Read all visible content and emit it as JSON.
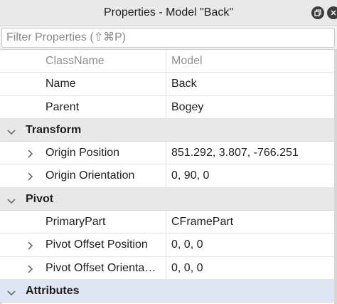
{
  "window": {
    "title": "Properties - Model \"Back\""
  },
  "filter": {
    "placeholder": "Filter Properties (⇧⌘P)"
  },
  "rows": [
    {
      "kind": "prop",
      "key": "ClassName",
      "value": "Model",
      "dim": true,
      "expandable": false
    },
    {
      "kind": "prop",
      "key": "Name",
      "value": "Back",
      "dim": false,
      "expandable": false
    },
    {
      "kind": "prop",
      "key": "Parent",
      "value": "Bogey",
      "dim": false,
      "expandable": false
    },
    {
      "kind": "section",
      "label": "Transform"
    },
    {
      "kind": "prop",
      "key": "Origin Position",
      "value": "851.292, 3.807, -766.251",
      "dim": false,
      "expandable": true
    },
    {
      "kind": "prop",
      "key": "Origin Orientation",
      "value": "0, 90, 0",
      "dim": false,
      "expandable": true
    },
    {
      "kind": "section",
      "label": "Pivot"
    },
    {
      "kind": "prop",
      "key": "PrimaryPart",
      "value": "CFramePart",
      "dim": false,
      "expandable": false
    },
    {
      "kind": "prop",
      "key": "Pivot Offset Position",
      "value": "0, 0, 0",
      "dim": false,
      "expandable": true
    },
    {
      "kind": "prop",
      "key": "Pivot Offset Orienta…",
      "value": "0, 0, 0",
      "dim": false,
      "expandable": true
    },
    {
      "kind": "section",
      "label": "Attributes",
      "accent": true
    }
  ],
  "icons": {
    "window_button_1": "restore-icon",
    "window_button_2": "close-icon",
    "expand": "chevron-right-icon",
    "collapse": "chevron-down-icon"
  },
  "colors": {
    "titlebar": "#e9e9e9",
    "section_header": "#e8e8e8",
    "attributes_header": "#dde6f2",
    "dim_text": "#8f8f8f"
  }
}
